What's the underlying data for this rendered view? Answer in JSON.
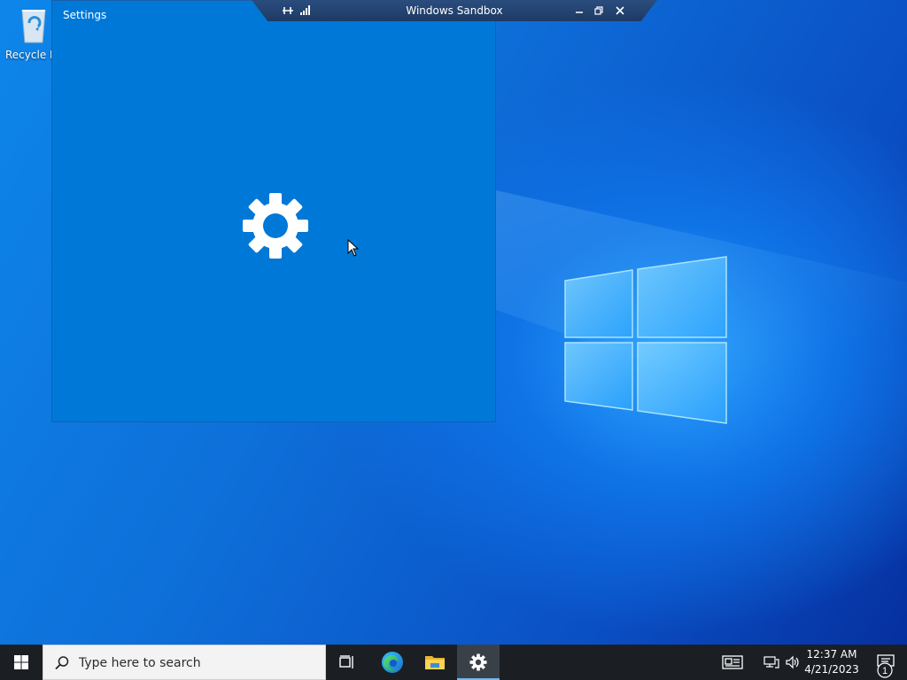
{
  "desktop": {
    "recycle_bin_label": "Recycle Bin"
  },
  "settings_window": {
    "title": "Settings"
  },
  "sandbox_bar": {
    "title": "Windows Sandbox"
  },
  "taskbar": {
    "search_placeholder": "Type here to search",
    "pinned": [
      "task-view",
      "edge",
      "file-explorer",
      "settings"
    ],
    "active_app": "settings",
    "clock_time": "12:37 AM",
    "clock_date": "4/21/2023",
    "notification_count": "1"
  },
  "colors": {
    "settings_bg": "#0078d7",
    "taskbar_bg": "#1b1f24",
    "accent": "#76b9ed"
  }
}
